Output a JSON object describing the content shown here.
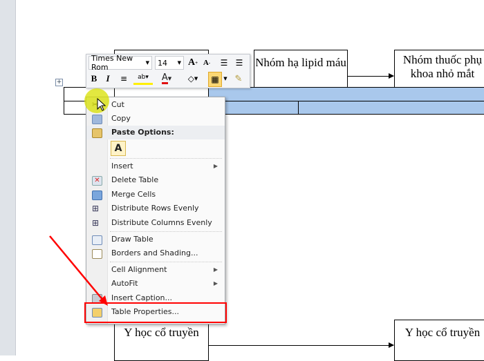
{
  "document": {
    "boxes": [
      "Nhóm hạ lipid máu",
      "Nhóm thuốc phụ khoa nhỏ mắt",
      "Y học cổ truyền",
      "Y học cổ truyền"
    ]
  },
  "toolbar": {
    "font": "Times New Rom",
    "size": "14",
    "bold": "B",
    "italic": "I",
    "font_color": "A"
  },
  "menu": {
    "cut": "Cut",
    "copy": "Copy",
    "paste_options": "Paste Options:",
    "paste_keep": "A",
    "insert": "Insert",
    "delete_table": "Delete Table",
    "merge_cells": "Merge Cells",
    "distribute_rows": "Distribute Rows Evenly",
    "distribute_columns": "Distribute Columns Evenly",
    "draw_table": "Draw Table",
    "borders_shading": "Borders and Shading...",
    "cell_alignment": "Cell Alignment",
    "autofit": "AutoFit",
    "insert_caption": "Insert Caption...",
    "table_properties": "Table Properties..."
  },
  "colors": {
    "highlight_box": "#ff0000",
    "selection": "#a9c8ec",
    "cursor_halo": "#d8e000"
  }
}
